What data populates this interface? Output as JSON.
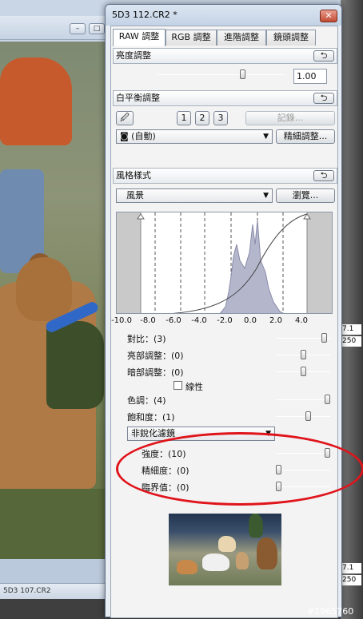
{
  "background": {
    "status_text": "5D3 107.CR2",
    "readouts": [
      "7.1",
      "250",
      "7.1",
      "250"
    ],
    "window_controls": [
      "–",
      "□"
    ]
  },
  "palette": {
    "title": "5D3 112.CR2 *",
    "close_glyph": "✕",
    "tabs": [
      "RAW 調整",
      "RGB 調整",
      "進階調整",
      "鏡頭調整"
    ],
    "brightness": {
      "header": "亮度調整",
      "value": "1.00",
      "reset_glyph": "⮌"
    },
    "white_balance": {
      "header": "白平衡調整",
      "eyedropper_glyph": "🖉",
      "presets": [
        "1",
        "2",
        "3"
      ],
      "register_label": "記錄...",
      "mode_value": "(自動)",
      "fine_tune_label": "精細調整..."
    },
    "picture_style": {
      "header": "風格樣式",
      "style_value": "風景",
      "browse_label": "瀏覽...",
      "histogram_axis": [
        "-10.0",
        "-8.0",
        "-6.0",
        "-4.0",
        "-2.0",
        "0.0",
        "2.0",
        "4.0"
      ],
      "rows": [
        {
          "label": "對比：(3)",
          "level": 0.93
        },
        {
          "label": "亮部調整：(0)",
          "level": 0.5
        },
        {
          "label": "暗部調整：(0)",
          "level": 0.5
        },
        {
          "label": "色調：(4)",
          "level": 1.0
        },
        {
          "label": "飽和度：(1)",
          "level": 0.6
        }
      ],
      "linear_label": "線性",
      "sharpen_mode": "非銳化濾鏡",
      "sharpen_rows": [
        {
          "label": "強度：(10)",
          "level": 1.0
        },
        {
          "label": "精細度：(0)",
          "level": 0.0
        },
        {
          "label": "臨界值：(0)",
          "level": 0.0
        }
      ]
    }
  },
  "watermark": "#1965760",
  "colors": {
    "annotation": "#e0141b",
    "titlebar": "#c3d2e5"
  }
}
